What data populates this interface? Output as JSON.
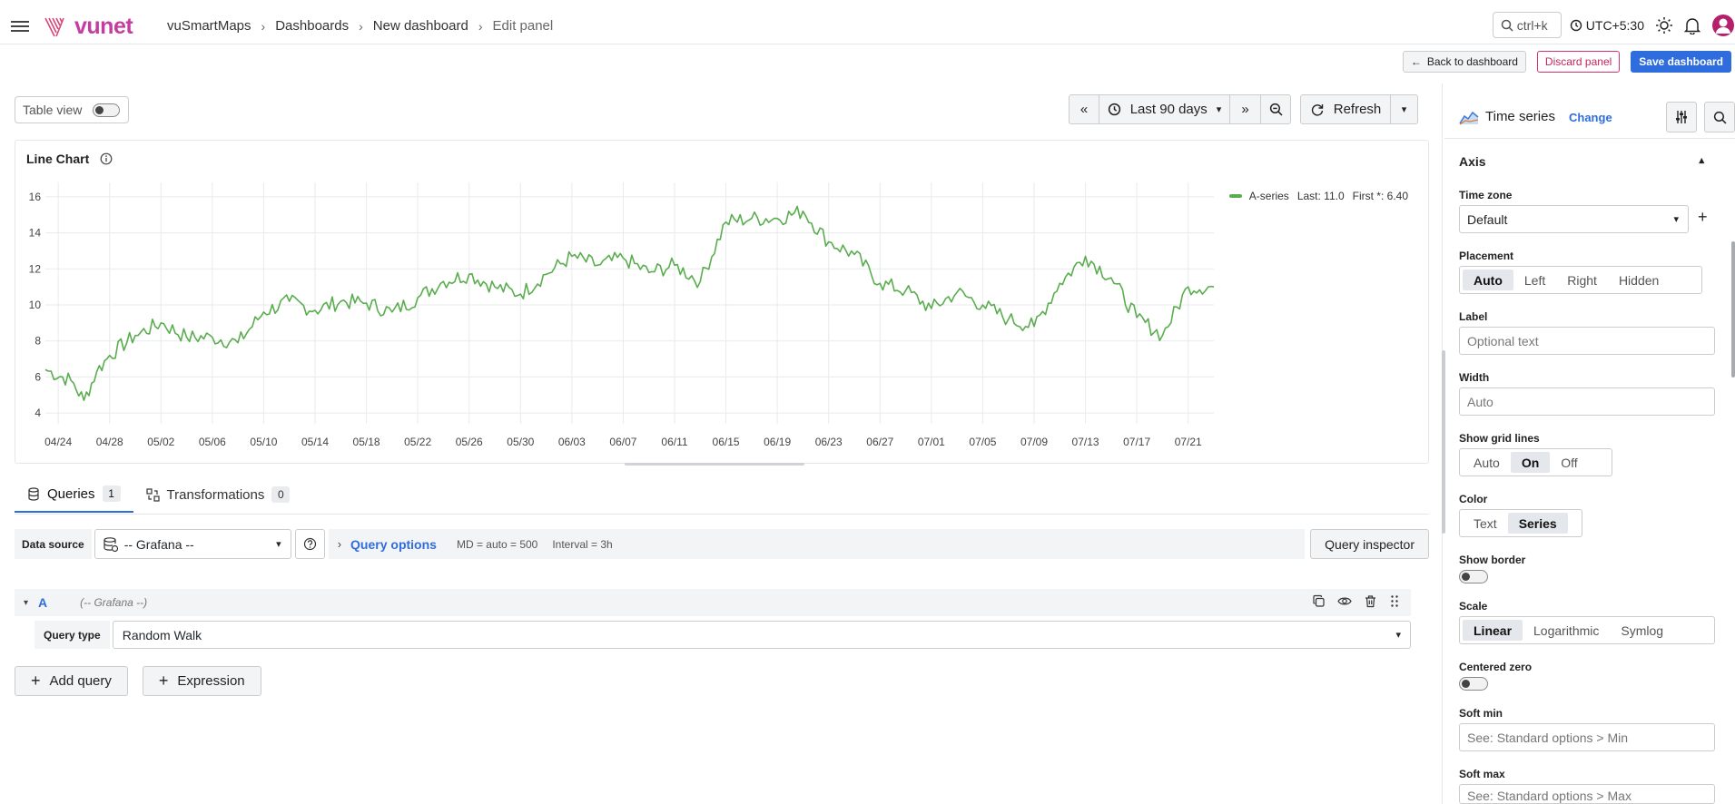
{
  "brand": {
    "logo_text": "vunet"
  },
  "breadcrumb": [
    "vuSmartMaps",
    "Dashboards",
    "New dashboard",
    "Edit panel"
  ],
  "topbar": {
    "search_hint": "ctrl+k",
    "timezone": "UTC+5:30"
  },
  "actions": {
    "back": "Back to dashboard",
    "discard": "Discard panel",
    "save": "Save dashboard"
  },
  "toolbar": {
    "table_view": "Table view",
    "time_range": "Last 90 days",
    "refresh": "Refresh"
  },
  "panel": {
    "title": "Line Chart"
  },
  "legend": {
    "series": "A-series",
    "last": "Last: 11.0",
    "first": "First *: 6.40",
    "color": "#5aad4e"
  },
  "chart_data": {
    "type": "line",
    "title": "Line Chart",
    "x_tick_labels": [
      "04/24",
      "04/28",
      "05/02",
      "05/06",
      "05/10",
      "05/14",
      "05/18",
      "05/22",
      "05/26",
      "05/30",
      "06/03",
      "06/07",
      "06/11",
      "06/15",
      "06/19",
      "06/23",
      "06/27",
      "07/01",
      "07/05",
      "07/09",
      "07/13",
      "07/17",
      "07/21"
    ],
    "y_tick_labels": [
      "4",
      "6",
      "8",
      "10",
      "12",
      "14",
      "16"
    ],
    "ylim": [
      3.5,
      16.5
    ],
    "grid": true,
    "legend_placement": "top-right",
    "series": [
      {
        "name": "A-series",
        "color": "#5aad4e",
        "x": [
          "04/23",
          "04/25",
          "04/26",
          "04/27",
          "04/28",
          "04/30",
          "05/02",
          "05/04",
          "05/06",
          "05/08",
          "05/10",
          "05/12",
          "05/14",
          "05/16",
          "05/18",
          "05/20",
          "05/22",
          "05/24",
          "05/26",
          "05/28",
          "05/30",
          "06/01",
          "06/03",
          "06/05",
          "06/07",
          "06/09",
          "06/11",
          "06/13",
          "06/15",
          "06/17",
          "06/19",
          "06/21",
          "06/23",
          "06/25",
          "06/27",
          "06/29",
          "07/01",
          "07/03",
          "07/05",
          "07/07",
          "07/09",
          "07/11",
          "07/13",
          "07/15",
          "07/17",
          "07/19",
          "07/21",
          "07/23"
        ],
        "values": [
          6.4,
          5.8,
          4.7,
          6.3,
          7.2,
          8.3,
          9.0,
          8.2,
          8.2,
          7.9,
          9.6,
          10.2,
          9.7,
          10.2,
          10.1,
          9.6,
          10.4,
          11.3,
          11.7,
          11.0,
          10.6,
          11.7,
          12.7,
          12.2,
          12.6,
          11.8,
          12.2,
          11.3,
          14.6,
          14.8,
          14.8,
          15.2,
          13.5,
          12.8,
          11.2,
          10.8,
          9.8,
          10.7,
          10.0,
          9.2,
          8.8,
          11.2,
          12.7,
          11.5,
          9.3,
          8.3,
          11.0,
          11.0
        ]
      }
    ]
  },
  "tabs": [
    {
      "label": "Queries",
      "count": "1"
    },
    {
      "label": "Transformations",
      "count": "0"
    }
  ],
  "query": {
    "ds_label": "Data source",
    "ds_value": "-- Grafana --",
    "options_label": "Query options",
    "md": "MD = auto = 500",
    "interval": "Interval = 3h",
    "inspector": "Query inspector",
    "ref": "A",
    "ref_ds": "(-- Grafana --)",
    "type_label": "Query type",
    "type_value": "Random Walk",
    "add_query": "Add query",
    "expression": "Expression"
  },
  "side": {
    "viz": "Time series",
    "change": "Change",
    "section": "Axis",
    "timezone_label": "Time zone",
    "timezone_value": "Default",
    "placement_label": "Placement",
    "placement_opts": [
      "Auto",
      "Left",
      "Right",
      "Hidden"
    ],
    "label_label": "Label",
    "label_ph": "Optional text",
    "width_label": "Width",
    "width_ph": "Auto",
    "grid_label": "Show grid lines",
    "grid_opts": [
      "Auto",
      "On",
      "Off"
    ],
    "color_label": "Color",
    "color_opts": [
      "Text",
      "Series"
    ],
    "border_label": "Show border",
    "scale_label": "Scale",
    "scale_opts": [
      "Linear",
      "Logarithmic",
      "Symlog"
    ],
    "centered_label": "Centered zero",
    "softmin_label": "Soft min",
    "softmin_ph": "See: Standard options > Min",
    "softmax_label": "Soft max",
    "softmax_ph": "See: Standard options > Max"
  }
}
